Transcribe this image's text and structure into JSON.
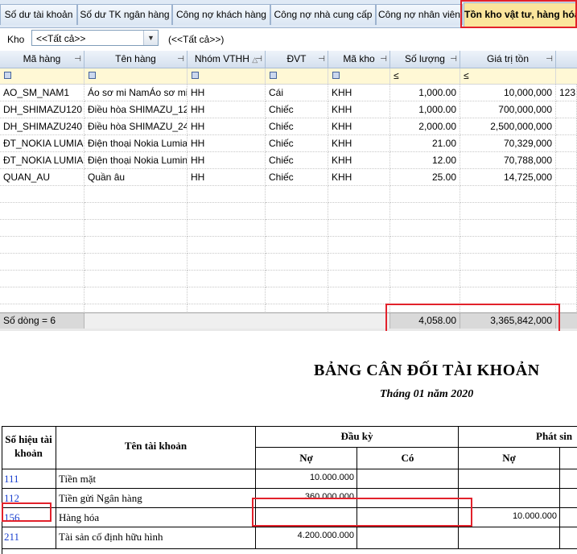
{
  "tabs": [
    {
      "label": "Số dư tài khoản"
    },
    {
      "label": "Số dư TK ngân hàng"
    },
    {
      "label": "Công nợ khách hàng"
    },
    {
      "label": "Công nợ nhà cung cấp"
    },
    {
      "label": "Công nợ nhân viên"
    },
    {
      "label": "Tồn kho vật tư, hàng hóa"
    }
  ],
  "filter": {
    "label": "Kho",
    "value": "<<Tất cả>>",
    "note": "(<<Tất cả>>)"
  },
  "grid": {
    "columns": [
      "Mã hàng",
      "Tên hàng",
      "Nhóm VTHH",
      "ĐVT",
      "Mã kho",
      "Số lượng",
      "Giá trị tồn"
    ],
    "filter_row": [
      "",
      "",
      "",
      "",
      "",
      "≤",
      "≤"
    ],
    "rows": [
      [
        "AO_SM_NAM1",
        "Áo sơ mi NamÁo sơ mi",
        "HH",
        "Cái",
        "KHH",
        "1,000.00",
        "10,000,000",
        "123"
      ],
      [
        "DH_SHIMAZU120",
        "Điều hòa SHIMAZU_12",
        "HH",
        "Chiếc",
        "KHH",
        "1,000.00",
        "700,000,000",
        ""
      ],
      [
        "DH_SHIMAZU240",
        "Điều hòa SHIMAZU_24",
        "HH",
        "Chiếc",
        "KHH",
        "2,000.00",
        "2,500,000,000",
        ""
      ],
      [
        "ĐT_NOKIA LUMIA",
        "Điện thoại Nokia Lumia",
        "HH",
        "Chiếc",
        "KHH",
        "21.00",
        "70,329,000",
        ""
      ],
      [
        "ĐT_NOKIA LUMIA",
        "Điện thoại Nokia Lumin",
        "HH",
        "Chiếc",
        "KHH",
        "12.00",
        "70,788,000",
        ""
      ],
      [
        "QUAN_AU",
        "Quần âu",
        "HH",
        "Chiếc",
        "KHH",
        "25.00",
        "14,725,000",
        ""
      ]
    ],
    "footer": {
      "row_count": "Số dòng = 6",
      "total_qty": "4,058.00",
      "total_value": "3,365,842,000"
    }
  },
  "report": {
    "title": "BẢNG CÂN ĐỐI TÀI KHOẢN",
    "subtitle": "Tháng 01 năm 2020",
    "headers": {
      "account_no": "Số hiệu tài khoản",
      "account_name": "Tên tài khoản",
      "opening": "Đầu kỳ",
      "activity": "Phát sin",
      "debit": "Nợ",
      "credit": "Có",
      "debit2": "Nợ"
    },
    "rows": [
      {
        "no": "111",
        "name": "Tiền mặt",
        "debit": "10.000.000",
        "credit": "",
        "act_debit": ""
      },
      {
        "no": "112",
        "name": "Tiền gửi Ngân hàng",
        "debit": "360.000.000",
        "credit": "",
        "act_debit": ""
      },
      {
        "no": "156",
        "name": "Hàng hóa",
        "debit": "",
        "credit": "",
        "act_debit": "10.000.000"
      },
      {
        "no": "211",
        "name": "Tài sản cố định hữu hình",
        "debit": "4.200.000.000",
        "credit": "",
        "act_debit": ""
      }
    ]
  },
  "colors": {
    "highlight": "#e2212b",
    "active_tab": "#fbe59c",
    "filter_row": "#fff8d5",
    "account_link": "#1a3fcf"
  }
}
